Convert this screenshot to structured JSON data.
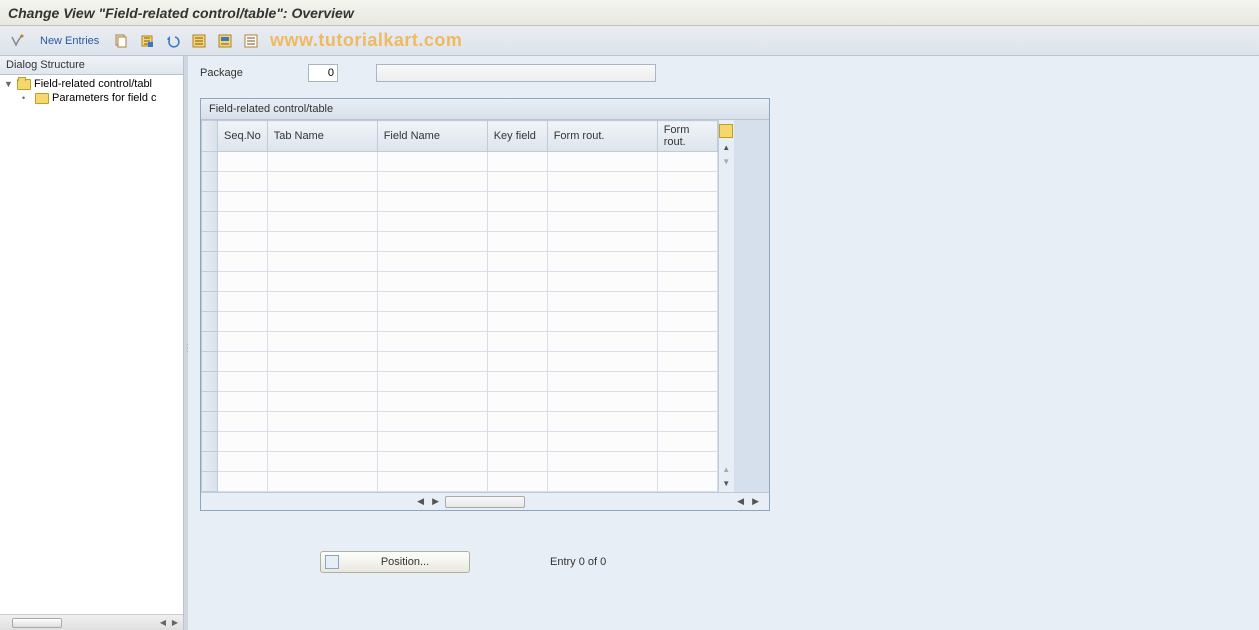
{
  "title": "Change View \"Field-related control/table\": Overview",
  "toolbar": {
    "new_entries_label": "New Entries"
  },
  "watermark": "www.tutorialkart.com",
  "sidebar": {
    "header": "Dialog Structure",
    "items": [
      {
        "label": "Field-related control/tabl",
        "selected": true
      },
      {
        "label": "Parameters for field c",
        "selected": false
      }
    ]
  },
  "form": {
    "package_label": "Package",
    "package_value": "0",
    "description_value": ""
  },
  "table": {
    "title": "Field-related control/table",
    "columns": [
      "Seq.No",
      "Tab Name",
      "Field Name",
      "Key field",
      "Form rout.",
      "Form rout."
    ],
    "row_count": 17
  },
  "footer": {
    "position_label": "Position...",
    "entry_text": "Entry 0 of 0"
  }
}
